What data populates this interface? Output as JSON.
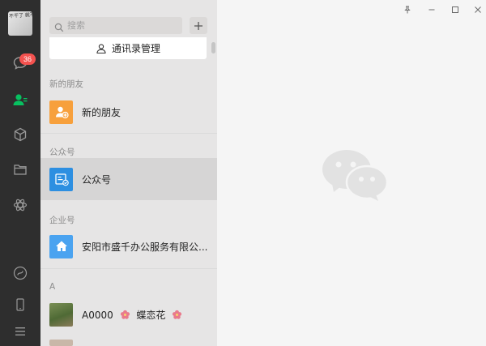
{
  "sidebar": {
    "avatar_text": "不干了 就不干了",
    "chat_badge": "36"
  },
  "panel": {
    "search_placeholder": "搜索",
    "contacts_manager_label": "通讯录管理",
    "sections": [
      {
        "header": "新的朋友",
        "item": "新的朋友"
      },
      {
        "header": "公众号",
        "item": "公众号"
      },
      {
        "header": "企业号",
        "item": "安阳市盛千办公服务有限公..."
      },
      {
        "header": "A",
        "item": "A0000",
        "item_suffix": "蝶恋花"
      }
    ]
  },
  "colors": {
    "rail": "#2e2e2e",
    "active_green": "#07c160",
    "badge_red": "#f4524f",
    "new_friends_orange": "#f7a03c",
    "official_blue": "#2d8fe1",
    "enterprise_blue": "#4aa3f0"
  }
}
